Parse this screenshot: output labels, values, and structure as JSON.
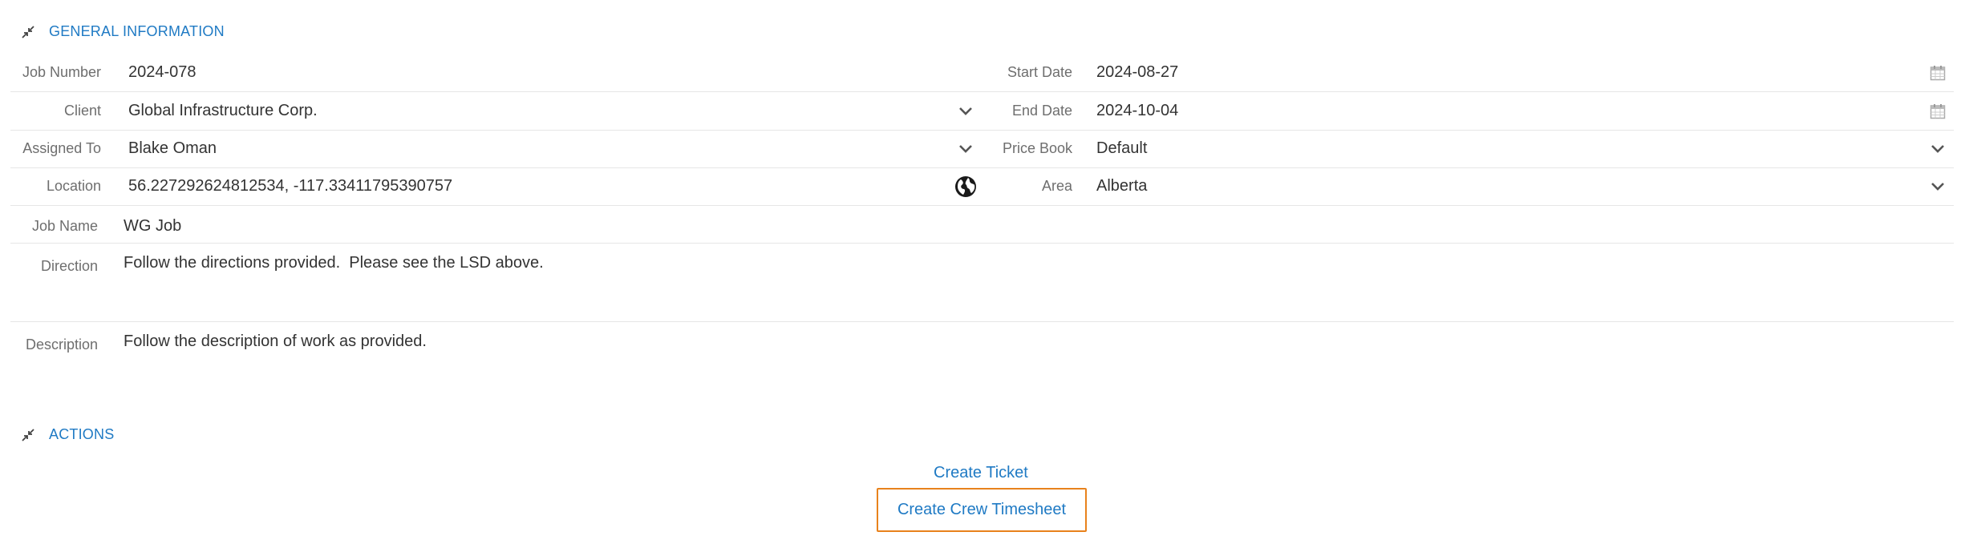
{
  "general": {
    "title": "GENERAL INFORMATION",
    "left": [
      {
        "label": "Job Number",
        "value": "2024-078",
        "control": "none"
      },
      {
        "label": "Client",
        "value": "Global Infrastructure Corp.",
        "control": "dropdown"
      },
      {
        "label": "Assigned To",
        "value": "Blake Oman",
        "control": "dropdown"
      },
      {
        "label": "Location",
        "value": "56.227292624812534, -117.33411795390757",
        "control": "globe"
      }
    ],
    "right": [
      {
        "label": "Start Date",
        "value": "2024-08-27",
        "control": "calendar"
      },
      {
        "label": "End Date",
        "value": "2024-10-04",
        "control": "calendar"
      },
      {
        "label": "Price Book",
        "value": "Default",
        "control": "dropdown"
      },
      {
        "label": "Area",
        "value": "Alberta",
        "control": "dropdown"
      }
    ],
    "job_name": {
      "label": "Job Name",
      "value": "WG Job"
    },
    "direction": {
      "label": "Direction",
      "value": "Follow the directions provided.  Please see the LSD above."
    },
    "description": {
      "label": "Description",
      "value": "Follow the description of work as provided."
    }
  },
  "actions": {
    "title": "ACTIONS",
    "create_ticket": "Create Ticket",
    "create_crew_timesheet": "Create Crew Timesheet"
  },
  "colors": {
    "accent": "#1f7ac4",
    "focus_border": "#e8821c",
    "label": "#6e6e6e",
    "divider": "#e6e6e6"
  },
  "icons": {
    "collapse": "collapse-arrows-icon",
    "dropdown": "chevron-down-icon",
    "calendar": "calendar-icon",
    "globe": "globe-icon"
  }
}
